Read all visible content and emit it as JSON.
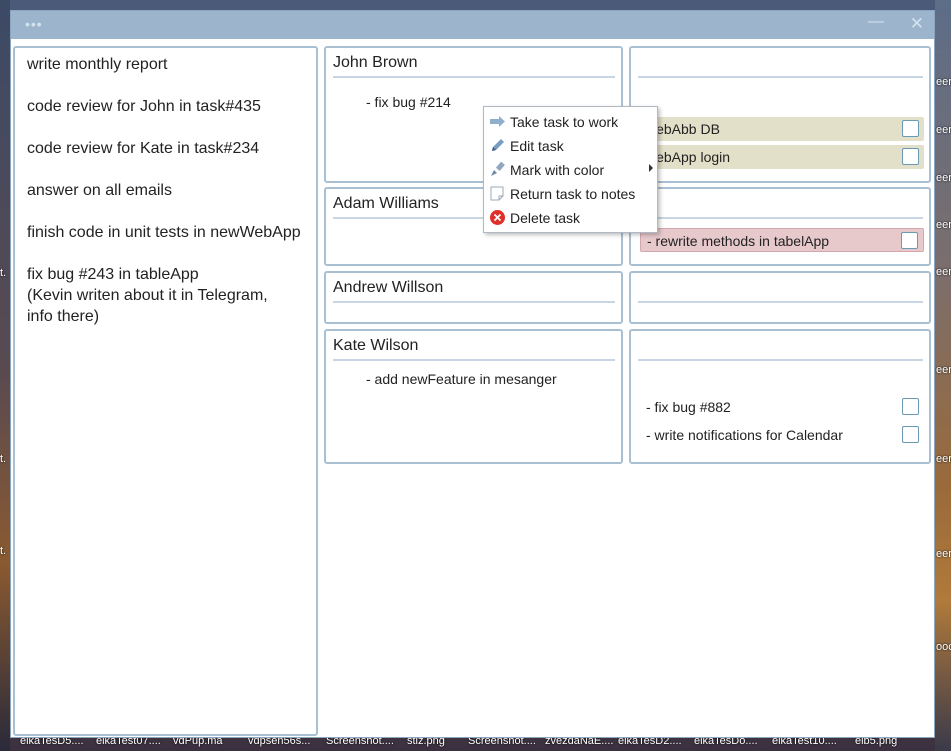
{
  "desktop": {
    "right_labels": [
      "eer",
      "eer",
      "eer",
      "eer",
      "eer",
      "eer",
      "eer",
      "eer",
      "ooc"
    ],
    "left_labels": [
      "t.",
      "t.",
      "t."
    ],
    "taskbar_files": [
      "eikaTesD5....",
      "eikaTest07....",
      "vdPup.ma",
      "vdpsen56s...",
      "Screenshot....",
      "stiz.png",
      "Screenshot....",
      "zvezdaNaE....",
      "eikaTesD2....",
      "eikaTesDo....",
      "eikaTest10....",
      "eib5.png"
    ]
  },
  "window": {
    "title_dots": "•••",
    "minimize_glyph": "—",
    "close_glyph": "✕"
  },
  "notes": [
    {
      "lines": [
        "write monthly report"
      ]
    },
    {
      "lines": [
        "code review for John in task#435"
      ]
    },
    {
      "lines": [
        "code review for Kate in task#234"
      ]
    },
    {
      "lines": [
        "answer on all emails"
      ]
    },
    {
      "lines": [
        "finish code in unit tests in newWebApp"
      ]
    },
    {
      "lines": [
        "fix bug #243 in tableApp",
        "(Kevin writen about it in Telegram,",
        "info there)"
      ]
    }
  ],
  "people": [
    {
      "name": "John Brown",
      "tasks": [
        "- fix bug #214"
      ]
    },
    {
      "name": "Adam Williams",
      "tasks": []
    },
    {
      "name": "Andrew Willson",
      "tasks": []
    },
    {
      "name": "Kate Wilson",
      "tasks": [
        "- add newFeature in mesanger"
      ]
    }
  ],
  "work_columns": [
    {
      "tasks": [
        {
          "text": "webAbb DB",
          "color": "#e3e0c9",
          "checked": false
        },
        {
          "text": "webApp login",
          "color": "#e3e0c9",
          "checked": false
        }
      ]
    },
    {
      "tasks": [
        {
          "text": "- rewrite methods in tabelApp",
          "color": "#e7c9cc",
          "checked": false
        }
      ]
    },
    {
      "tasks": []
    },
    {
      "tasks": [
        {
          "text": "- fix bug #882",
          "color": "#ffffff",
          "checked": false
        },
        {
          "text": "- write notifications for Calendar",
          "color": "#ffffff",
          "checked": false
        }
      ]
    }
  ],
  "context_menu": {
    "items": [
      {
        "label": "Take task to work",
        "icon": "arrow-right-icon"
      },
      {
        "label": "Edit task",
        "icon": "pencil-icon"
      },
      {
        "label": "Mark with color",
        "icon": "paint-brush-icon",
        "submenu": true
      },
      {
        "label": "Return task to notes",
        "icon": "note-icon"
      },
      {
        "label": "Delete task",
        "icon": "delete-icon"
      }
    ]
  },
  "colors": {
    "titlebar": "#9cb5cc",
    "panel_border": "#a9c0d3",
    "beige_task": "#e3e0c9",
    "pink_task": "#e7c9cc",
    "delete_red": "#e0302a"
  }
}
